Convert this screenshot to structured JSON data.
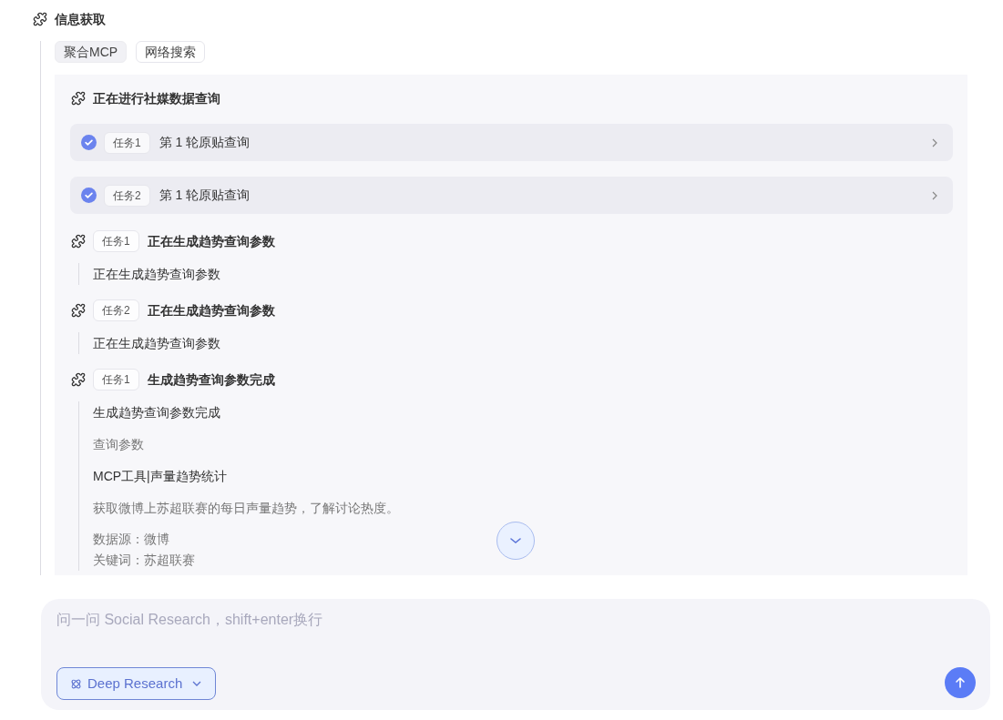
{
  "section": {
    "title": "信息获取"
  },
  "sources": [
    {
      "label": "聚合MCP",
      "selected": true
    },
    {
      "label": "网络搜索",
      "selected": false
    }
  ],
  "panel": {
    "title": "正在进行社媒数据查询",
    "tasks": [
      {
        "badge": "任务1",
        "title": "第 1 轮原贴查询",
        "done": true
      },
      {
        "badge": "任务2",
        "title": "第 1 轮原贴查询",
        "done": true
      }
    ],
    "steps": [
      {
        "badge": "任务1",
        "title": "正在生成趋势查询参数",
        "content": [
          {
            "kind": "primary",
            "text": "正在生成趋势查询参数"
          }
        ]
      },
      {
        "badge": "任务2",
        "title": "正在生成趋势查询参数",
        "content": [
          {
            "kind": "primary",
            "text": "正在生成趋势查询参数"
          }
        ]
      },
      {
        "badge": "任务1",
        "title": "生成趋势查询参数完成",
        "content": [
          {
            "kind": "primary",
            "text": "生成趋势查询参数完成"
          },
          {
            "kind": "secondary",
            "text": "查询参数"
          },
          {
            "kind": "primary",
            "text": "MCP工具|声量趋势统计"
          },
          {
            "kind": "secondary",
            "text": "获取微博上苏超联赛的每日声量趋势，了解讨论热度。"
          },
          {
            "kind": "fields",
            "lines": [
              "数据源：微博",
              "关键词：苏超联赛"
            ]
          }
        ]
      }
    ]
  },
  "composer": {
    "placeholder": "问一问 Social Research，shift+enter换行",
    "mode": "Deep Research"
  }
}
